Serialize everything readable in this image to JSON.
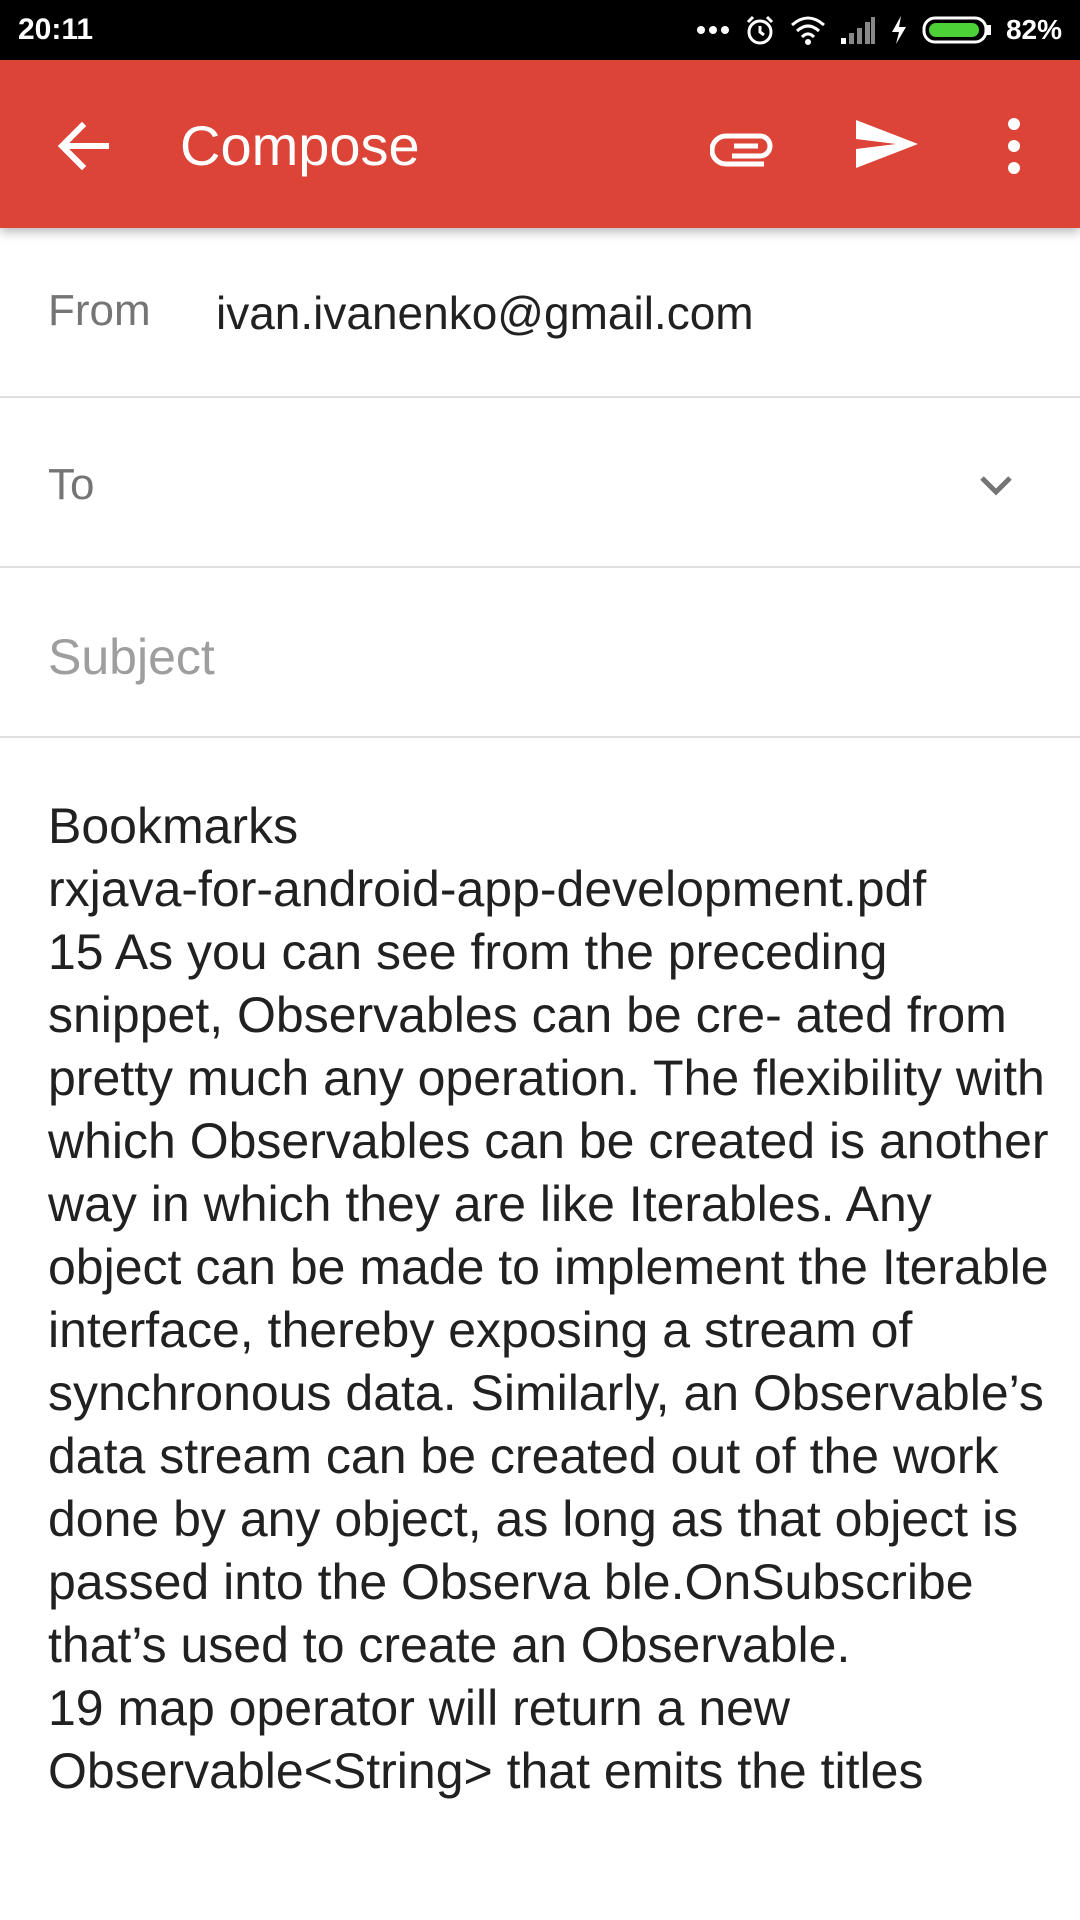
{
  "status_bar": {
    "time": "20:11",
    "battery_percent": "82%",
    "icons": [
      "more-dots-icon",
      "alarm-icon",
      "wifi-icon",
      "signal-icon",
      "charging-icon",
      "battery-icon"
    ]
  },
  "app_bar": {
    "title": "Compose",
    "color": "#db4437",
    "icons": [
      "back-arrow-icon",
      "paperclip-icon",
      "send-icon",
      "more-vert-icon"
    ]
  },
  "from": {
    "label": "From",
    "value": "ivan.ivanenko@gmail.com"
  },
  "to": {
    "label": "To",
    "value": ""
  },
  "subject": {
    "placeholder": "Subject",
    "value": ""
  },
  "body": {
    "text": "Bookmarks\nrxjava-for-android-app-development.pdf\n15 As you can see from the preceding snippet, Observables can be cre- ated from pretty much any operation. The flexibility with which Observables can be created is another way in which they are like Iterables. Any object can be made to implement the Iterable interface, thereby exposing a stream of synchronous data. Similarly, an Observable’s data stream can be created out of the work done by any object, as long as that object is passed into the Observa ble.OnSubscribe that’s used to create an Observable.\n19 map operator will return a new Observable<String> that emits the titles"
  }
}
